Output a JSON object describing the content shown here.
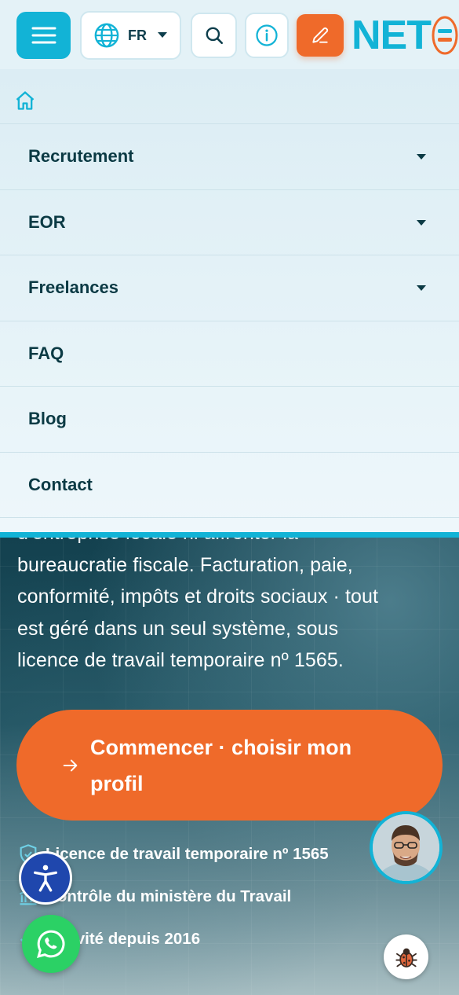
{
  "header": {
    "language_code": "FR",
    "logo_text": "NET"
  },
  "nav": {
    "items": [
      {
        "label": "Recrutement",
        "has_dropdown": true
      },
      {
        "label": "EOR",
        "has_dropdown": true
      },
      {
        "label": "Freelances",
        "has_dropdown": true
      },
      {
        "label": "FAQ",
        "has_dropdown": false
      },
      {
        "label": "Blog",
        "has_dropdown": false
      },
      {
        "label": "Contact",
        "has_dropdown": false
      }
    ]
  },
  "hero": {
    "cut_line": "d'entreprise locale ni affronter la",
    "lines": [
      "bureaucratie fiscale. Facturation, paie,",
      "conformité, impôts et droits sociaux · tout",
      "est géré dans un seul système, sous",
      "licence de travail temporaire nº 1565."
    ],
    "cta_label": "Commencer · choisir mon profil",
    "features": [
      {
        "icon": "shield-check-icon",
        "text": "Licence de travail temporaire nº 1565"
      },
      {
        "icon": "bank-icon",
        "text": "Contrôle du ministère du Travail"
      },
      {
        "icon": "check-icon",
        "text": "Activité depuis 2016"
      }
    ]
  },
  "colors": {
    "accent_cyan": "#12b3d6",
    "accent_orange": "#ef6a2a",
    "nav_text": "#0b3a44",
    "whatsapp_green": "#2bd165",
    "accessibility_blue": "#1f47ad"
  },
  "icons": [
    "menu-icon",
    "globe-icon",
    "caret-down-icon",
    "search-icon",
    "info-icon",
    "pencil-icon",
    "home-icon",
    "arrow-right-icon",
    "accessibility-icon",
    "whatsapp-icon",
    "bug-icon"
  ]
}
